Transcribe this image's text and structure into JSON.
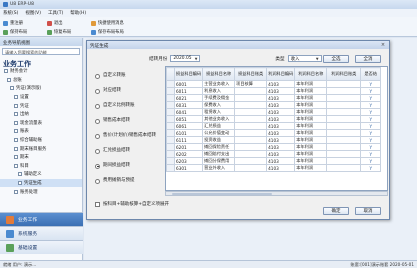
{
  "app": {
    "title": "U8 ERP-U8"
  },
  "menu": [
    "系统(S)",
    "视图(V)",
    "工具(T)",
    "帮助(H)"
  ],
  "toolbar": [
    {
      "label": "重注册",
      "color": "#4a8ad0"
    },
    {
      "label": "退出",
      "color": "#d0504a"
    },
    {
      "label": "快捷使用消息",
      "color": "#e09a3a"
    },
    {
      "label": "保持布局",
      "color": "#5aa05a"
    },
    {
      "label": "恢复布局",
      "color": "#5aa05a"
    },
    {
      "label": "保存布局布局",
      "color": "#4a8ad0"
    }
  ],
  "leftpane": {
    "header": "业务导航视图",
    "search_placeholder": "请输入您要搜索的功能",
    "title": "业务工作",
    "tree": [
      "财务会计",
      "总账",
      "凭证(演示版)",
      "设置",
      "凭证",
      "出纳",
      "现金流量表",
      "账表",
      "综合辅助账",
      "期末账目服务",
      "期末",
      "科目",
      "辅助定义",
      "凭证生成",
      "账务处理"
    ],
    "selected_index": 13,
    "bottom_nav": [
      "业务工作",
      "系统服务",
      "基础设置"
    ]
  },
  "dialog": {
    "title": "凭证生成",
    "close": "×",
    "period_label": "结转月份",
    "period_value": "2020.05",
    "type_label": "类型",
    "type_value": "收入",
    "btn_select_all": "全选",
    "btn_deselect_all": "全消",
    "btn_ok": "确定",
    "btn_cancel": "取消",
    "checkbox_label": "按科目+辅助核算+自定义项展开",
    "radios": [
      {
        "label": "自定义转账",
        "checked": false
      },
      {
        "label": "对应结转",
        "checked": false
      },
      {
        "label": "自定义比例转账",
        "checked": false
      },
      {
        "label": "销售成本结转",
        "checked": false
      },
      {
        "label": "售价(计划价)销售成本结转",
        "checked": false
      },
      {
        "label": "汇兑损益结转",
        "checked": false
      },
      {
        "label": "期间损益结转",
        "checked": true
      },
      {
        "label": "费用摊销与预提",
        "checked": false
      }
    ],
    "columns": [
      "",
      "损益科目编码",
      "损益科目名称",
      "损益科目账类",
      "利润科目编码",
      "利润科目名称",
      "利润科目账类",
      "是否结"
    ],
    "rows": [
      [
        "6001",
        "主营业务收入",
        "项目核算",
        "4103",
        "本年利润",
        "",
        "Y"
      ],
      [
        "6011",
        "利息收入",
        "",
        "4103",
        "本年利润",
        "",
        "Y"
      ],
      [
        "6021",
        "手续费及佣金",
        "",
        "4103",
        "本年利润",
        "",
        "Y"
      ],
      [
        "6031",
        "保费收入",
        "",
        "4103",
        "本年利润",
        "",
        "Y"
      ],
      [
        "6041",
        "租赁收入",
        "",
        "4103",
        "本年利润",
        "",
        "Y"
      ],
      [
        "6051",
        "其他业务收入",
        "",
        "4103",
        "本年利润",
        "",
        "Y"
      ],
      [
        "6061",
        "汇兑损益",
        "",
        "4103",
        "本年利润",
        "",
        "Y"
      ],
      [
        "6101",
        "公允价值变动",
        "",
        "4103",
        "本年利润",
        "",
        "Y"
      ],
      [
        "6111",
        "投资收益",
        "",
        "4103",
        "本年利润",
        "",
        "Y"
      ],
      [
        "6201",
        "摊回保险责任",
        "",
        "4103",
        "本年利润",
        "",
        "Y"
      ],
      [
        "6202",
        "摊回赔付支出",
        "",
        "4103",
        "本年利润",
        "",
        "Y"
      ],
      [
        "6203",
        "摊回分保费用",
        "",
        "4103",
        "本年利润",
        "",
        "Y"
      ],
      [
        "6301",
        "营业外收入",
        "",
        "4103",
        "本年利润",
        "",
        "Y"
      ]
    ]
  },
  "status": {
    "left": "就绪  用户: 演示...",
    "right": "账套:[001]演示账套  2020-05-01"
  }
}
